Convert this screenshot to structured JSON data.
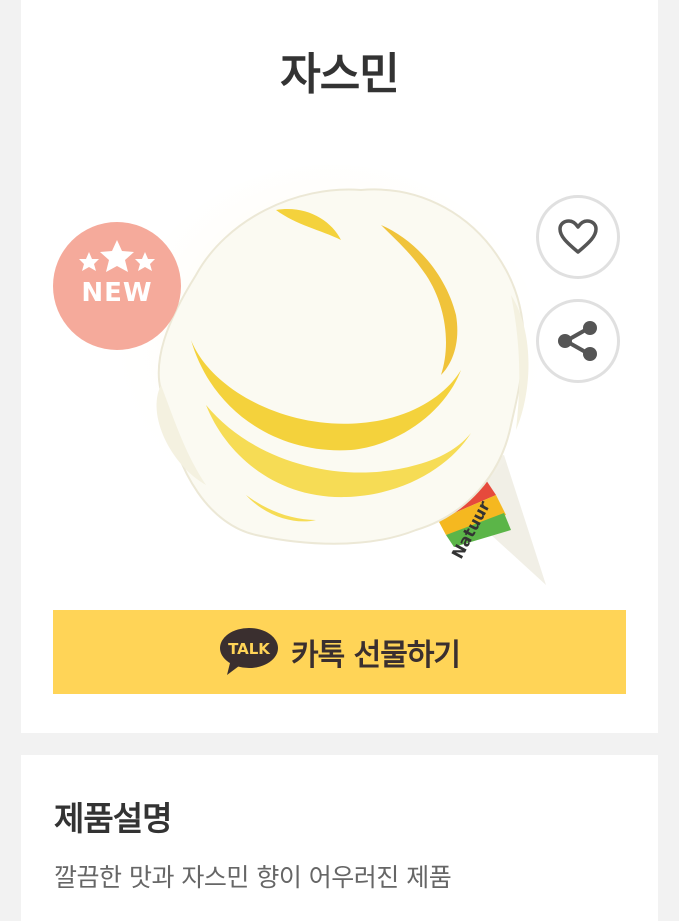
{
  "product": {
    "name": "자스민",
    "badge": "NEW"
  },
  "actions": {
    "wish_icon": "heart-icon",
    "share_icon": "share-icon",
    "kakao_icon_text": "TALK",
    "kakao_gift_label": "카톡 선물하기"
  },
  "description": {
    "heading": "제품설명",
    "text": "깔끔한 맛과 자스민 향이 어우러진 제품"
  },
  "colors": {
    "background": "#f2f2f2",
    "badge": "#f5aa9b",
    "kakao": "#ffd457",
    "title": "#333333"
  }
}
